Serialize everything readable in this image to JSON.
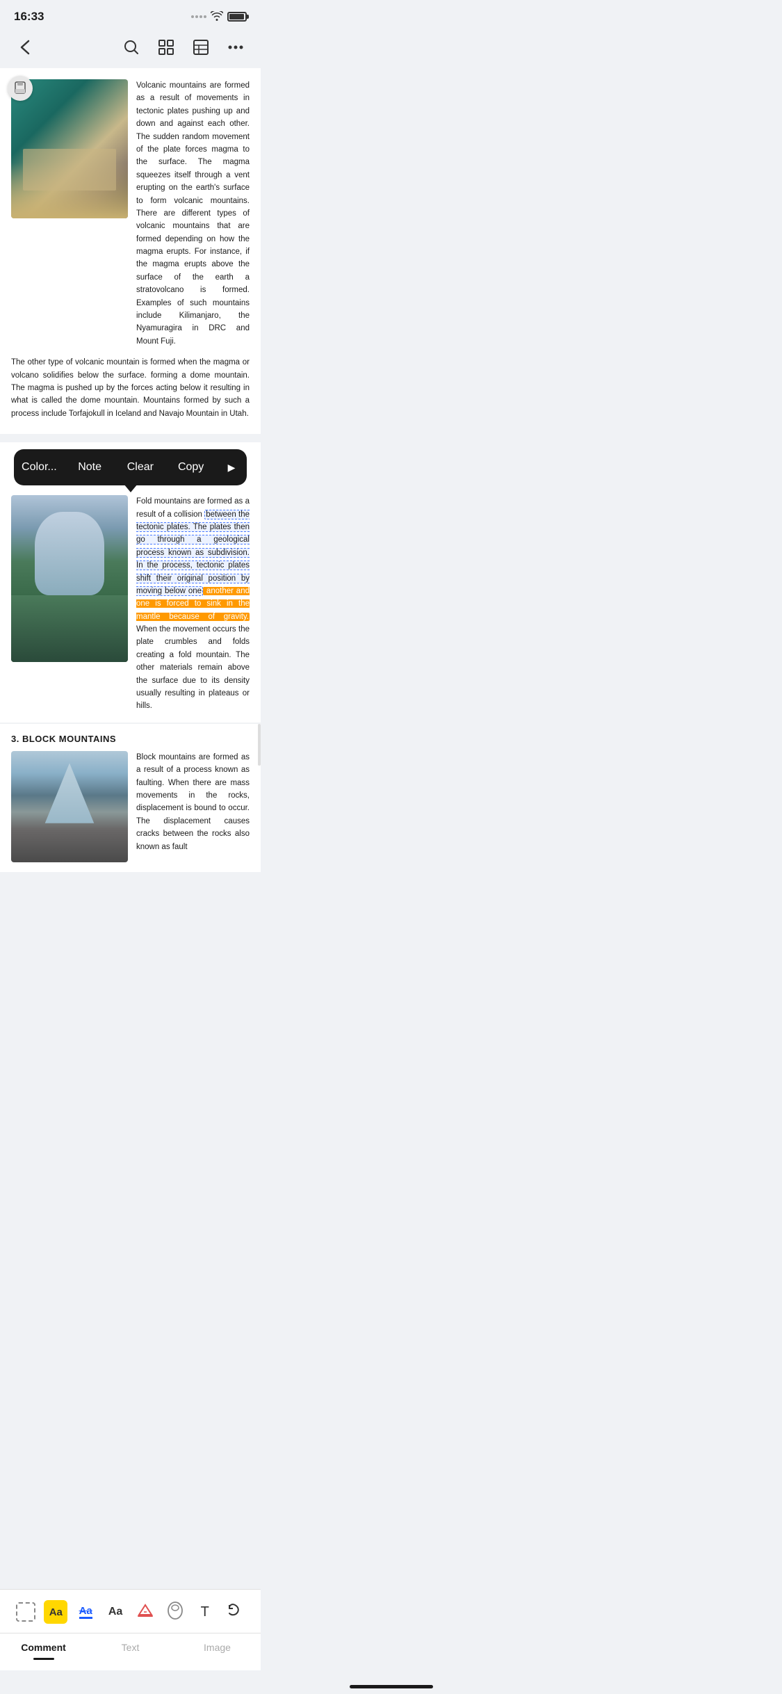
{
  "status": {
    "time": "16:33",
    "battery": "full"
  },
  "nav": {
    "back_label": "‹",
    "search_label": "🔍"
  },
  "popup": {
    "items": [
      "Color...",
      "Note",
      "Clear",
      "Copy"
    ],
    "arrow_label": "▶"
  },
  "content": {
    "section1_text": "Volcanic mountains are formed as a result of movements in tectonic plates pushing up and down and against each other. The sudden random movement of the plate forces magma to the surface. The magma squeezes itself through a vent erupting on the earth's surface to form volcanic mountains. There are different types of volcanic mountains that are formed depending on how the magma erupts. For instance, if the magma erupts above the surface of the earth a stratovolcano is formed. Examples of such mountains include Kilimanjaro, the Nyamuragira in DRC and Mount Fuji.",
    "section1_text2": "The other type of volcanic mountain is formed when the magma or volcano solidifies below the surface. forming a dome mountain. The magma is pushed up by the forces acting below it resulting in what is called the dome mountain. Mountains formed by such a process include Torfajokull in Iceland and Navajo Mountain in Utah.",
    "fold_intro": "Fold mountains are formed as a result of a collision ",
    "fold_highlight1": "between the tectonic plates. The plates then go through a geological process known as subdivision. In the process, tectonic plates shift their original position by moving below one",
    "fold_text2": " another and one is forced to sink in the mantle because of gravity. When the movement occurs the plate crumbles and folds creating a fold mountain. The other materials remain above the surface due to its density usually resulting in plateaus or hills.",
    "section3_header": "3. BLOCK MOUNTAINS",
    "block_text": "Block mountains are formed as a result of a process known as faulting. When there are mass movements in the rocks, displacement is bound to occur. The displacement causes cracks between the rocks also known as fault"
  },
  "toolbar": {
    "tools": [
      {
        "name": "selection",
        "label": "□"
      },
      {
        "name": "highlight-yellow",
        "label": "Aa"
      },
      {
        "name": "highlight-blue",
        "label": "Aa"
      },
      {
        "name": "text",
        "label": "Aa"
      },
      {
        "name": "eraser-color",
        "label": "🖍"
      },
      {
        "name": "eraser",
        "label": "◇"
      },
      {
        "name": "text-insert",
        "label": "T"
      },
      {
        "name": "undo",
        "label": "↩"
      }
    ]
  },
  "tabs": {
    "items": [
      "Comment",
      "Text",
      "Image"
    ],
    "active": 0
  }
}
